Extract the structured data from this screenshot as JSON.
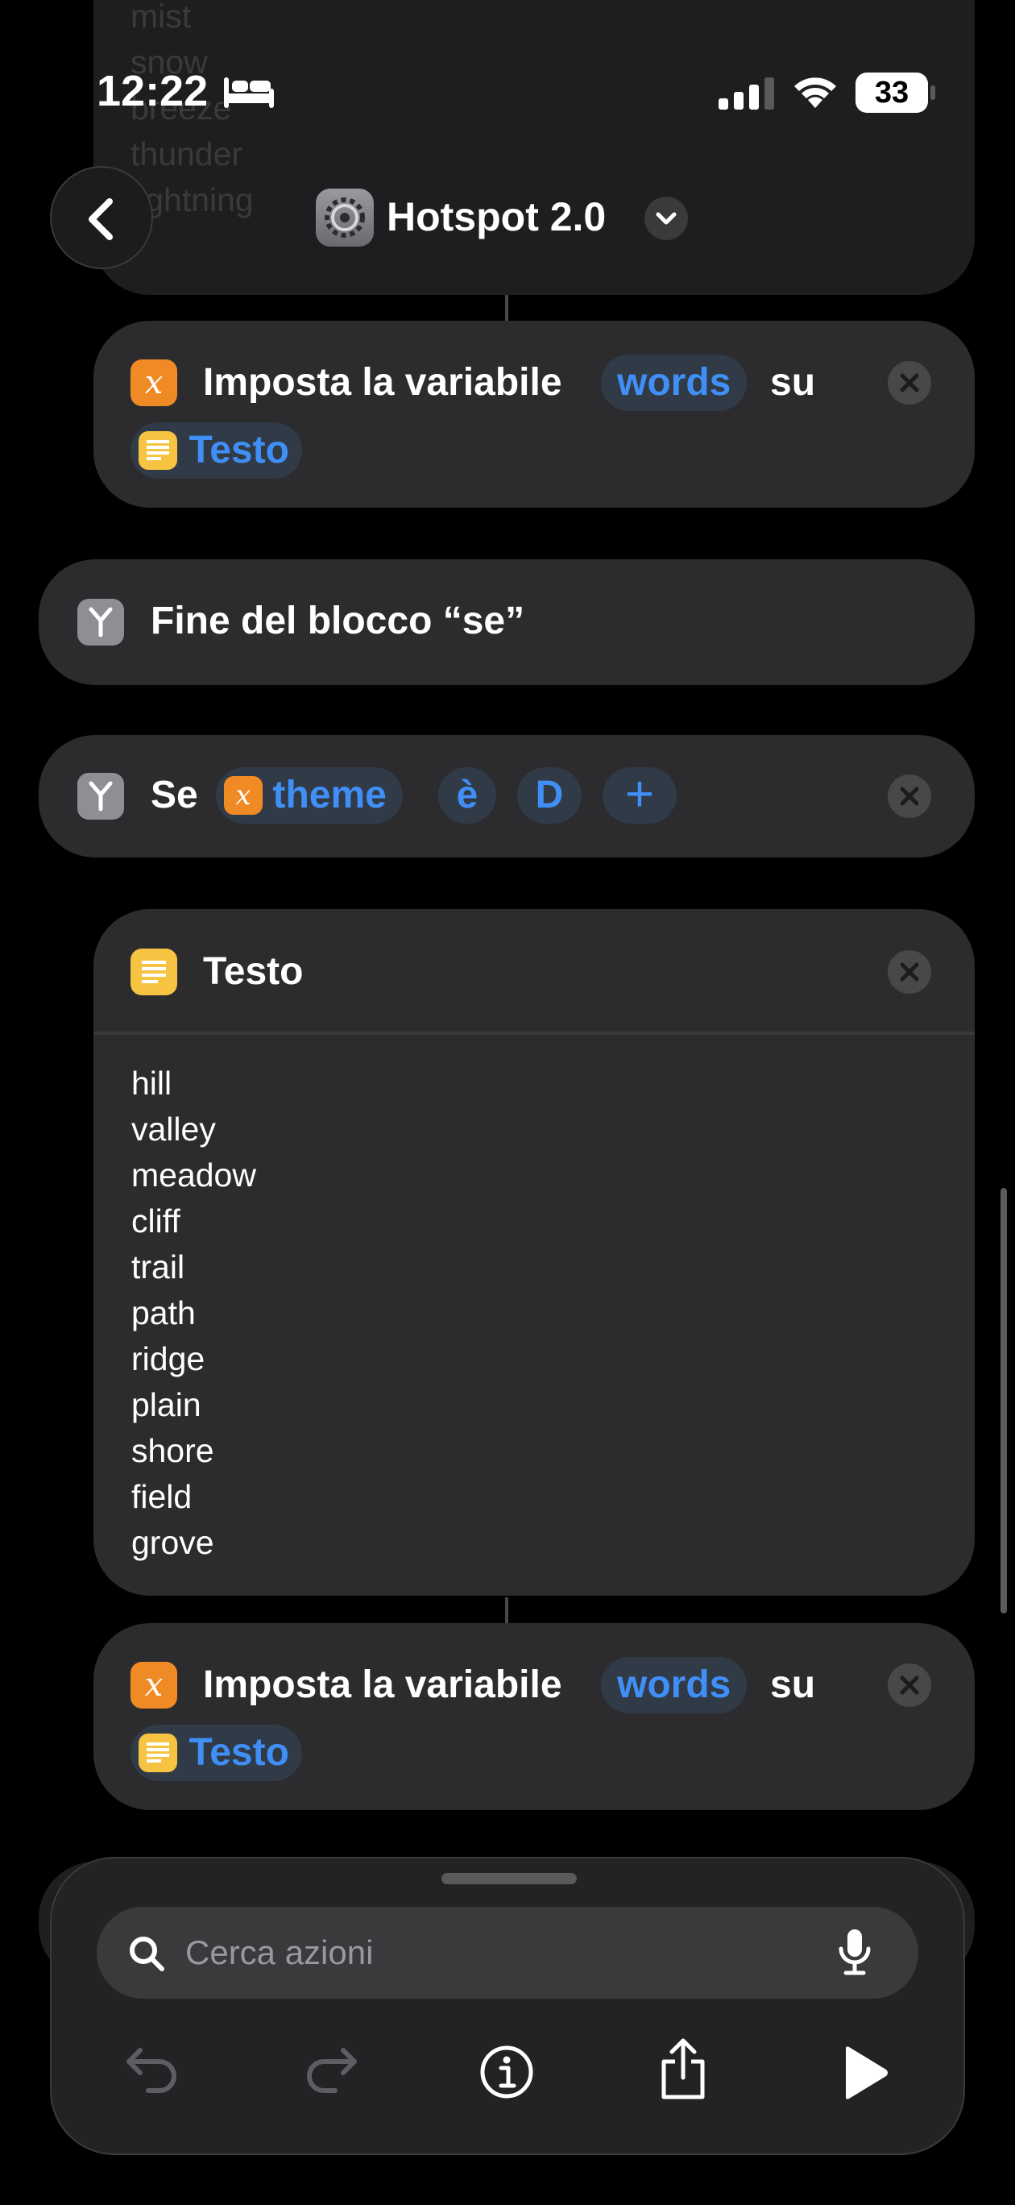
{
  "status_bar": {
    "time": "12:22",
    "battery": "33"
  },
  "nav": {
    "title": "Hotspot 2.0"
  },
  "faded_list": [
    "mist",
    "snow",
    "breeze",
    "thunder",
    "lightning"
  ],
  "set_var_1": {
    "label": "Imposta la variabile",
    "variable": "words",
    "su": "su",
    "value": "Testo"
  },
  "end_if": {
    "label": "Fine del blocco “se”"
  },
  "if_block": {
    "label": "Se",
    "variable": "theme",
    "operator": "è",
    "value": "D",
    "add": "+"
  },
  "text_block": {
    "title": "Testo",
    "lines": [
      "hill",
      "valley",
      "meadow",
      "cliff",
      "trail",
      "path",
      "ridge",
      "plain",
      "shore",
      "field",
      "grove"
    ]
  },
  "set_var_2": {
    "label": "Imposta la variabile",
    "variable": "words",
    "su": "su",
    "value": "Testo"
  },
  "bottom_panel": {
    "search_placeholder": "Cerca azioni"
  },
  "colors": {
    "accent": "#3f8ff7",
    "card": "#2c2c2e",
    "variable_icon": "#f08a24",
    "text_icon": "#f6c342"
  }
}
